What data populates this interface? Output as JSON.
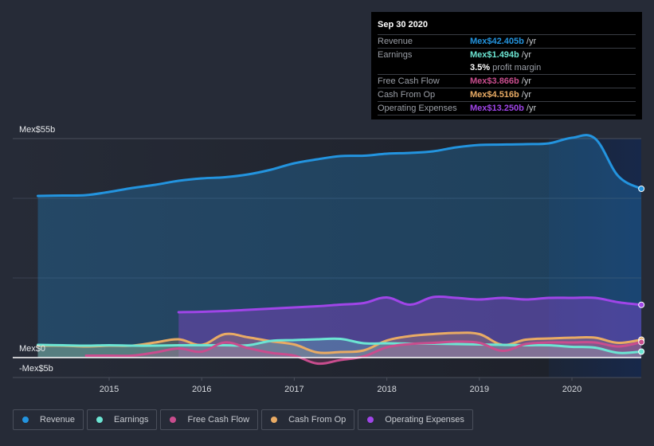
{
  "tooltip": {
    "date": "Sep 30 2020",
    "rows": [
      {
        "label": "Revenue",
        "value": "Mex$42.405b",
        "unit": "/yr",
        "color": "#2394df"
      },
      {
        "label": "Earnings",
        "value": "Mex$1.494b",
        "unit": "/yr",
        "color": "#6ce5d3"
      },
      {
        "label": "Free Cash Flow",
        "value": "Mex$3.866b",
        "unit": "/yr",
        "color": "#c94d8e"
      },
      {
        "label": "Cash From Op",
        "value": "Mex$4.516b",
        "unit": "/yr",
        "color": "#e9ab64"
      },
      {
        "label": "Operating Expenses",
        "value": "Mex$13.250b",
        "unit": "/yr",
        "color": "#a045e8"
      }
    ],
    "profit_margin_value": "3.5%",
    "profit_margin_label": "profit margin"
  },
  "legend": [
    {
      "label": "Revenue",
      "color": "#2394df"
    },
    {
      "label": "Earnings",
      "color": "#6ce5d3"
    },
    {
      "label": "Free Cash Flow",
      "color": "#c94d8e"
    },
    {
      "label": "Cash From Op",
      "color": "#e9ab64"
    },
    {
      "label": "Operating Expenses",
      "color": "#a045e8"
    }
  ],
  "chart_data": {
    "type": "area",
    "title": "",
    "xlabel": "",
    "ylabel": "",
    "y_tick_labels": {
      "top": "Mex$55b",
      "zero": "Mex$0",
      "bottom": "-Mex$5b"
    },
    "ylim": [
      -5,
      55
    ],
    "xlim": [
      2014.23,
      2020.75
    ],
    "x_ticks": [
      2015,
      2016,
      2017,
      2018,
      2019,
      2020
    ],
    "x_tick_labels": [
      "2015",
      "2016",
      "2017",
      "2018",
      "2019",
      "2020"
    ],
    "forecast_region_start": 2019.75,
    "grid": true,
    "series": [
      {
        "name": "Revenue",
        "color": "#2394df",
        "x": [
          2014.23,
          2014.5,
          2014.75,
          2015.0,
          2015.25,
          2015.5,
          2015.75,
          2016.0,
          2016.25,
          2016.5,
          2016.75,
          2017.0,
          2017.25,
          2017.5,
          2017.75,
          2018.0,
          2018.25,
          2018.5,
          2018.75,
          2019.0,
          2019.25,
          2019.5,
          2019.75,
          2020.0,
          2020.25,
          2020.5,
          2020.75
        ],
        "values": [
          40.6,
          40.7,
          40.8,
          41.6,
          42.6,
          43.4,
          44.4,
          45.0,
          45.3,
          46.0,
          47.2,
          48.8,
          49.8,
          50.6,
          50.7,
          51.2,
          51.4,
          51.8,
          52.8,
          53.4,
          53.5,
          53.6,
          53.8,
          55.2,
          55.0,
          45.6,
          42.4
        ]
      },
      {
        "name": "Earnings",
        "color": "#6ce5d3",
        "x": [
          2014.23,
          2014.5,
          2014.75,
          2015.0,
          2015.25,
          2015.5,
          2015.75,
          2016.0,
          2016.25,
          2016.5,
          2016.75,
          2017.0,
          2017.25,
          2017.5,
          2017.75,
          2018.0,
          2018.25,
          2018.5,
          2018.75,
          2019.0,
          2019.25,
          2019.5,
          2019.75,
          2020.0,
          2020.25,
          2020.5,
          2020.75
        ],
        "values": [
          3.2,
          3.1,
          3.0,
          3.1,
          3.0,
          3.0,
          3.1,
          3.1,
          3.1,
          3.1,
          4.2,
          4.4,
          4.6,
          4.7,
          3.6,
          3.6,
          3.5,
          3.5,
          3.4,
          3.3,
          3.2,
          3.1,
          3.1,
          2.7,
          2.5,
          1.2,
          1.5
        ]
      },
      {
        "name": "Free Cash Flow",
        "color": "#c94d8e",
        "x": [
          2014.75,
          2015.0,
          2015.25,
          2015.5,
          2015.75,
          2016.0,
          2016.25,
          2016.5,
          2016.75,
          2017.0,
          2017.25,
          2017.5,
          2017.75,
          2018.0,
          2018.25,
          2018.5,
          2018.75,
          2019.0,
          2019.25,
          2019.5,
          2019.75,
          2020.0,
          2020.25,
          2020.5,
          2020.75
        ],
        "values": [
          0.5,
          0.5,
          0.5,
          1.3,
          2.3,
          1.5,
          3.8,
          2.4,
          1.2,
          0.5,
          -1.5,
          -0.6,
          0.3,
          2.6,
          3.4,
          3.7,
          4.0,
          3.7,
          1.7,
          3.4,
          3.8,
          3.8,
          3.8,
          2.8,
          3.9
        ]
      },
      {
        "name": "Cash From Op",
        "color": "#e9ab64",
        "x": [
          2014.23,
          2014.5,
          2014.75,
          2015.0,
          2015.25,
          2015.5,
          2015.75,
          2016.0,
          2016.25,
          2016.5,
          2016.75,
          2017.0,
          2017.25,
          2017.5,
          2017.75,
          2018.0,
          2018.25,
          2018.5,
          2018.75,
          2019.0,
          2019.25,
          2019.5,
          2019.75,
          2020.0,
          2020.25,
          2020.5,
          2020.75
        ],
        "values": [
          3.0,
          3.0,
          2.8,
          3.0,
          3.0,
          3.8,
          4.6,
          3.2,
          5.9,
          5.1,
          4.1,
          3.3,
          1.3,
          1.4,
          1.8,
          4.3,
          5.4,
          5.9,
          6.2,
          5.9,
          3.2,
          4.5,
          4.8,
          5.0,
          5.0,
          3.7,
          4.5
        ]
      },
      {
        "name": "Operating Expenses",
        "color": "#a045e8",
        "x": [
          2015.75,
          2016.0,
          2016.25,
          2016.5,
          2016.75,
          2017.0,
          2017.25,
          2017.5,
          2017.75,
          2018.0,
          2018.25,
          2018.5,
          2018.75,
          2019.0,
          2019.25,
          2019.5,
          2019.75,
          2020.0,
          2020.25,
          2020.5,
          2020.75
        ],
        "values": [
          11.4,
          11.5,
          11.7,
          12.0,
          12.3,
          12.6,
          12.9,
          13.3,
          13.7,
          15.1,
          13.3,
          15.2,
          15.0,
          14.6,
          15.0,
          14.6,
          15.0,
          15.0,
          15.0,
          13.9,
          13.25
        ]
      }
    ]
  }
}
